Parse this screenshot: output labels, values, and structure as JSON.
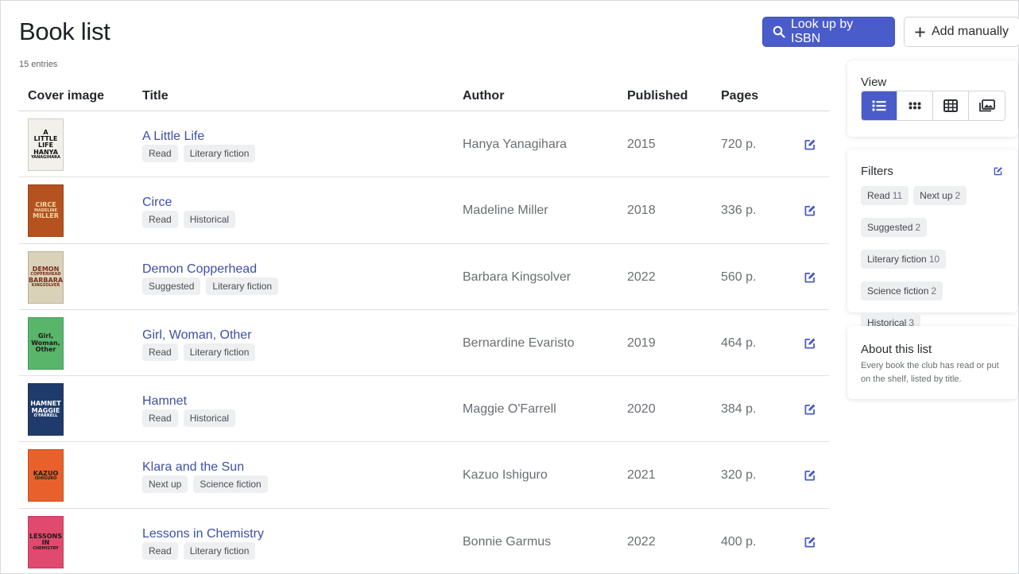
{
  "header": {
    "title": "Book list",
    "entry_count": "15 entries",
    "isbn_button": "Look up by ISBN",
    "add_button": "Add manually"
  },
  "table": {
    "columns": [
      "Cover image",
      "Title",
      "Author",
      "Published",
      "Pages"
    ],
    "rows": [
      {
        "title": "A Little Life",
        "tags": [
          "Read",
          "Literary fiction"
        ],
        "author": "Hanya Yanagihara",
        "published": "2015",
        "pages": "720 p.",
        "cover_bg": "#f2f0ea",
        "cover_fg": "#111111",
        "cover_text": [
          "A",
          "LITTLE",
          "LIFE",
          "HANYA",
          "YANAGIHARA"
        ]
      },
      {
        "title": "Circe",
        "tags": [
          "Read",
          "Historical"
        ],
        "author": "Madeline Miller",
        "published": "2018",
        "pages": "336 p.",
        "cover_bg": "#b4531f",
        "cover_fg": "#f2d8a8",
        "cover_text": [
          "CIRCE",
          "MADELINE",
          "MILLER"
        ]
      },
      {
        "title": "Demon Copperhead",
        "tags": [
          "Suggested",
          "Literary fiction"
        ],
        "author": "Barbara Kingsolver",
        "published": "2022",
        "pages": "560 p.",
        "cover_bg": "#d9d2b8",
        "cover_fg": "#7a2e1e",
        "cover_text": [
          "DEMON",
          "COPPERHEAD",
          "BARBARA",
          "KINGSOLVER"
        ]
      },
      {
        "title": "Girl, Woman, Other",
        "tags": [
          "Read",
          "Literary fiction"
        ],
        "author": "Bernardine Evaristo",
        "published": "2019",
        "pages": "464 p.",
        "cover_bg": "#58b56a",
        "cover_fg": "#1a1a1a",
        "cover_text": [
          "Girl,",
          "Woman,",
          "Other"
        ]
      },
      {
        "title": "Hamnet",
        "tags": [
          "Read",
          "Historical"
        ],
        "author": "Maggie O'Farrell",
        "published": "2020",
        "pages": "384 p.",
        "cover_bg": "#1f3b6b",
        "cover_fg": "#ffffff",
        "cover_text": [
          "HAMNET",
          "MAGGIE",
          "O'FARRELL"
        ]
      },
      {
        "title": "Klara and the Sun",
        "tags": [
          "Next up",
          "Science fiction"
        ],
        "author": "Kazuo Ishiguro",
        "published": "2021",
        "pages": "320 p.",
        "cover_bg": "#e8612c",
        "cover_fg": "#1a1a1a",
        "cover_text": [
          "KAZUO",
          "ISHIGURO"
        ]
      },
      {
        "title": "Lessons in Chemistry",
        "tags": [
          "Read",
          "Literary fiction"
        ],
        "author": "Bonnie Garmus",
        "published": "2022",
        "pages": "400 p.",
        "cover_bg": "#e04a6e",
        "cover_fg": "#1a1a1a",
        "cover_text": [
          "LESSONS",
          "IN",
          "CHEMISTRY"
        ]
      }
    ]
  },
  "sidebar": {
    "view": {
      "label": "View",
      "options": [
        "list-icon",
        "dots-icon",
        "table-icon",
        "gallery-icon"
      ],
      "active": "list-icon"
    },
    "filters": {
      "label": "Filters",
      "items": [
        {
          "label": "Read",
          "count": "11"
        },
        {
          "label": "Next up",
          "count": "2"
        },
        {
          "label": "Suggested",
          "count": "2"
        },
        {
          "label": "Literary fiction",
          "count": "10"
        },
        {
          "label": "Science fiction",
          "count": "2"
        },
        {
          "label": "Historical",
          "count": "3"
        }
      ]
    },
    "about": {
      "label": "About this list",
      "text": "Every book the club has read or put on the shelf, listed by title."
    }
  },
  "colors": {
    "accent": "#4a5cc9",
    "link": "#3d4fa8"
  }
}
